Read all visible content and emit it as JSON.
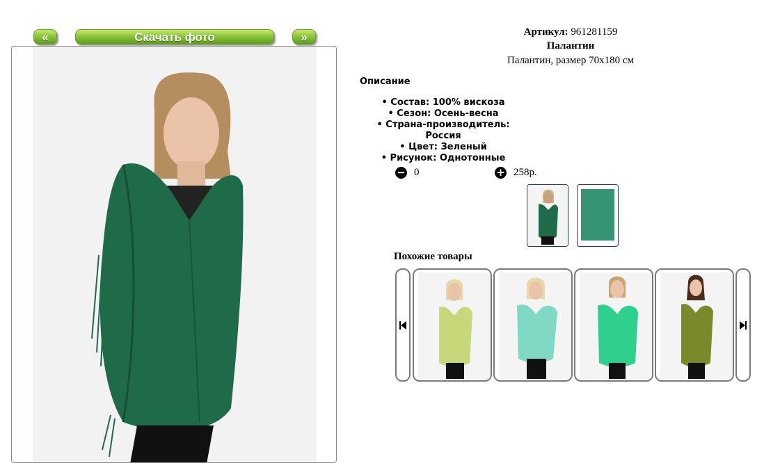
{
  "nav": {
    "prev_label": "«",
    "download_label": "Скачать фото",
    "next_label": "»"
  },
  "product": {
    "sku_label": "Артикул:",
    "sku_value": "961281159",
    "name": "Палантин",
    "subtitle": "Палантин, размер 70x180 см",
    "color_hex": "#1f6a48"
  },
  "description": {
    "title": "Описание",
    "items": [
      "Состав: 100% вискоза",
      "Сезон: Осень-весна",
      "Страна-производитель: Россия",
      "Цвет: Зеленый",
      "Рисунок: Однотонные"
    ]
  },
  "cart": {
    "minus_icon": "minus-circle-icon",
    "quantity": "0",
    "plus_icon": "plus-circle-icon",
    "price": "258р."
  },
  "similar": {
    "title": "Похожие товары",
    "prev_icon": "skip-previous-icon",
    "next_icon": "skip-next-icon",
    "items": [
      {
        "color": "#c6d87a"
      },
      {
        "color": "#7fd9c4"
      },
      {
        "color": "#2fcf8e"
      },
      {
        "color": "#7a8a2a"
      }
    ]
  }
}
